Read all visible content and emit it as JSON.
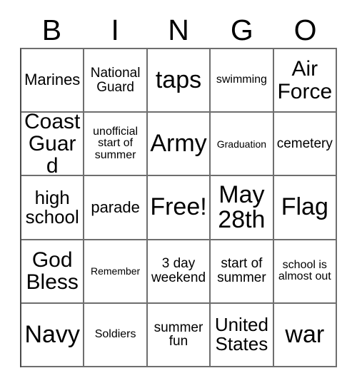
{
  "card": {
    "title_letters": [
      "B",
      "I",
      "N",
      "G",
      "O"
    ],
    "columns": 5,
    "rows": 5,
    "free_space": "Free!",
    "border_color": "#6e6e6e",
    "text_color": "#000000",
    "background_color": "#ffffff",
    "cells": [
      [
        {
          "text": "Marines",
          "size": "fs-m"
        },
        {
          "text": "National Guard",
          "size": "fs-s"
        },
        {
          "text": "taps",
          "size": "fs-xxl"
        },
        {
          "text": "swimming",
          "size": "fs-xs"
        },
        {
          "text": "Air Force",
          "size": "fs-xl"
        }
      ],
      [
        {
          "text": "Coast Guard",
          "size": "fs-xl"
        },
        {
          "text": "unofficial start of summer",
          "size": "fs-xs"
        },
        {
          "text": "Army",
          "size": "fs-xxl"
        },
        {
          "text": "Graduation",
          "size": "fs-xxs"
        },
        {
          "text": "cemetery",
          "size": "fs-s"
        }
      ],
      [
        {
          "text": "high school",
          "size": "fs-l"
        },
        {
          "text": "parade",
          "size": "fs-m"
        },
        {
          "text": "Free!",
          "size": "fs-xxl"
        },
        {
          "text": "May 28th",
          "size": "fs-xxl"
        },
        {
          "text": "Flag",
          "size": "fs-xxl"
        }
      ],
      [
        {
          "text": "God Bless",
          "size": "fs-xl"
        },
        {
          "text": "Remember",
          "size": "fs-xxs"
        },
        {
          "text": "3 day weekend",
          "size": "fs-s"
        },
        {
          "text": "start of summer",
          "size": "fs-s"
        },
        {
          "text": "school is almost out",
          "size": "fs-xs"
        }
      ],
      [
        {
          "text": "Navy",
          "size": "fs-xxl"
        },
        {
          "text": "Soldiers",
          "size": "fs-xs"
        },
        {
          "text": "summer fun",
          "size": "fs-s"
        },
        {
          "text": "United States",
          "size": "fs-l"
        },
        {
          "text": "war",
          "size": "fs-xxl"
        }
      ]
    ]
  }
}
